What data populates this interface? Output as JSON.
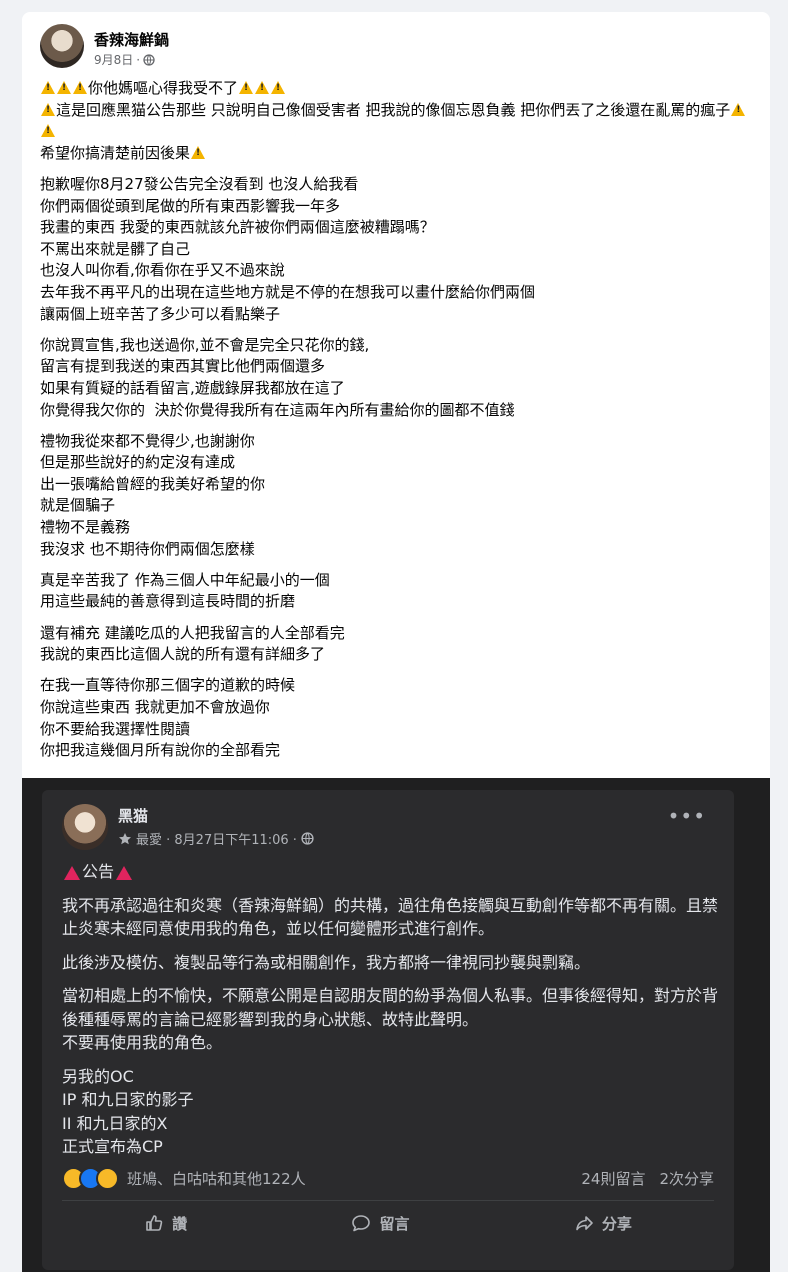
{
  "post": {
    "author": "香辣海鮮鍋",
    "date": "9月8日",
    "paragraphs": [
      [
        {
          "pre_warn": 3,
          "text": "你他媽嘔心得我受不了",
          "post_warn": 3
        },
        {
          "pre_warn": 1,
          "text": "這是回應黑猫公告那些 只說明自己像個受害者 把我說的像個忘恩負義 把你們丟了之後還在亂罵的瘋子",
          "post_warn": 2
        },
        {
          "pre_warn": 0,
          "text": "希望你搞清楚前因後果",
          "post_warn": 1
        }
      ],
      [
        {
          "text": "抱歉喔你8月27發公告完全沒看到 也沒人給我看"
        },
        {
          "text": "你們兩個從頭到尾做的所有東西影響我一年多"
        },
        {
          "text": "我畫的東西 我愛的東西就該允許被你們兩個這麼被糟蹋嗎？"
        },
        {
          "text": "不罵出來就是髒了自己"
        },
        {
          "text": "也沒人叫你看,你看你在乎又不過來說"
        },
        {
          "text": "去年我不再平凡的出現在這些地方就是不停的在想我可以畫什麼給你們兩個"
        },
        {
          "text": "讓兩個上班辛苦了多少可以看點樂子"
        }
      ],
      [
        {
          "text": "你說買宣售,我也送過你,並不會是完全只花你的錢,"
        },
        {
          "text": "留言有提到我送的東西其實比他們兩個還多"
        },
        {
          "text": "如果有質疑的話看留言,遊戲錄屏我都放在這了"
        },
        {
          "text": "你覺得我欠你的  決於你覺得我所有在這兩年內所有畫給你的圖都不值錢"
        }
      ],
      [
        {
          "text": "禮物我從來都不覺得少,也謝謝你"
        },
        {
          "text": "但是那些說好的約定沒有達成"
        },
        {
          "text": "出一張嘴給曾經的我美好希望的你"
        },
        {
          "text": "就是個騙子"
        },
        {
          "text": "禮物不是義務"
        },
        {
          "text": "我沒求 也不期待你們兩個怎麼樣"
        }
      ],
      [
        {
          "text": "真是辛苦我了 作為三個人中年紀最小的一個"
        },
        {
          "text": "用這些最純的善意得到這長時間的折磨"
        }
      ],
      [
        {
          "text": "還有補充 建議吃瓜的人把我留言的人全部看完"
        },
        {
          "text": "我說的東西比這個人說的所有還有詳細多了"
        }
      ],
      [
        {
          "text": "在我一直等待你那三個字的道歉的時候"
        },
        {
          "text": "你說這些東西 我就更加不會放過你"
        },
        {
          "text": "你不要給我選擇性閱讀"
        },
        {
          "text": "你把我這幾個月所有說你的全部看完"
        }
      ]
    ]
  },
  "screenshot": {
    "author": "黑猫",
    "meta": "最愛 · 8月27日下午11:06 ·",
    "title": "公告",
    "paragraphs": [
      [
        "我不再承認過往和炎寒（香辣海鮮鍋）的共構，過往角色接觸與互動創作等都不再有關。且禁止炎寒未經同意使用我的角色，並以任何變體形式進行創作。"
      ],
      [
        "此後涉及模仿、複製品等行為或相關創作，我方都將一律視同抄襲與剽竊。"
      ],
      [
        "當初相處上的不愉快，不願意公開是自認朋友間的紛爭為個人私事。但事後經得知，對方於背後種種辱罵的言論已經影響到我的身心狀態、故特此聲明。",
        "不要再使用我的角色。"
      ],
      [
        "另我的OC",
        "IP 和九日家的影子",
        "II  和九日家的X",
        "正式宣布為CP"
      ]
    ],
    "reactions_text": "班鳩、白咕咕和其他122人",
    "comments": "24則留言",
    "shares": "2次分享",
    "actions": {
      "like": "讚",
      "comment": "留言",
      "share": "分享"
    }
  }
}
